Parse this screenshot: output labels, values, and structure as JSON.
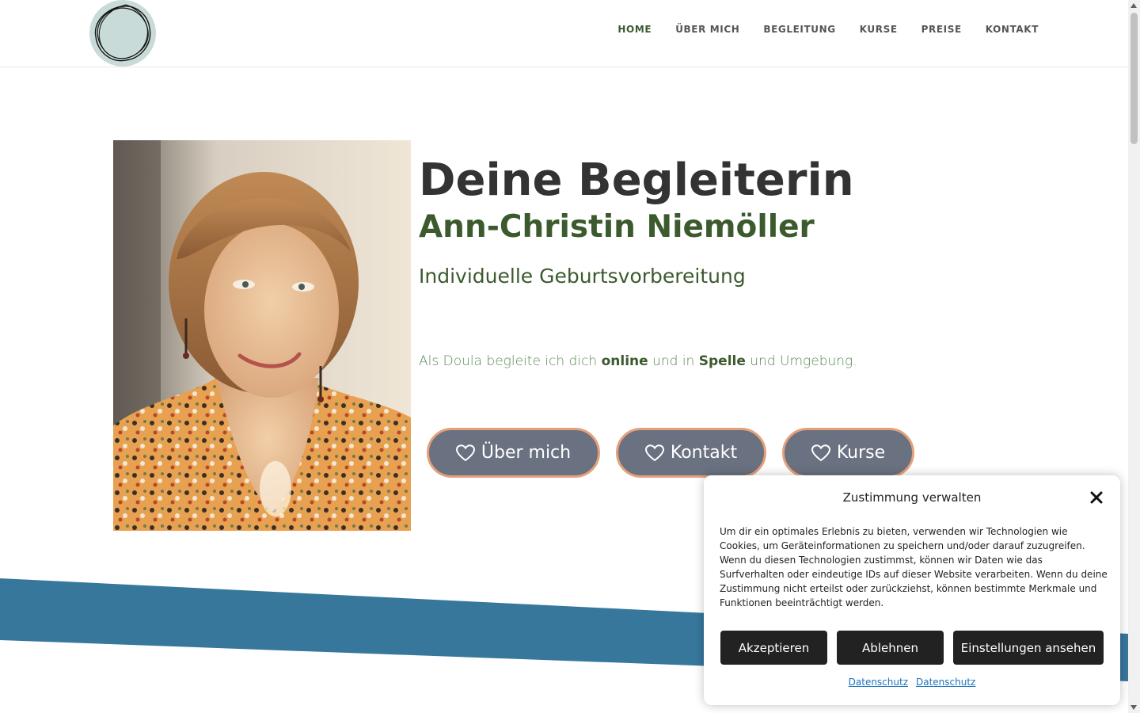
{
  "header": {
    "nav": [
      {
        "label": "HOME",
        "active": true
      },
      {
        "label": "ÜBER MICH"
      },
      {
        "label": "BEGLEITUNG"
      },
      {
        "label": "KURSE"
      },
      {
        "label": "PREISE"
      },
      {
        "label": "KONTAKT"
      }
    ]
  },
  "hero": {
    "title": "Deine Begleiterin",
    "name": "Ann-Christin Niemöller",
    "subtitle": "Individuelle Geburtsvorbereitung",
    "lead_part1": "Als Doula begleite ich dich ",
    "lead_bold1": "online",
    "lead_part2": " und in ",
    "lead_bold2": "Spelle",
    "lead_part3": " und Umgebung.",
    "buttons": {
      "about": "Über mich",
      "contact": "Kontakt",
      "courses": "Kurse"
    }
  },
  "consent": {
    "title": "Zustimmung verwalten",
    "text": "Um dir ein optimales Erlebnis zu bieten, verwenden wir Technologien wie Cookies, um Geräteinformationen zu speichern und/oder darauf zuzugreifen. Wenn du diesen Technologien zustimmst, können wir Daten wie das Surfverhalten oder eindeutige IDs auf dieser Website verarbeiten. Wenn du deine Zustimmung nicht erteilst oder zurückziehst, können bestimmte Merkmale und Funktionen beeinträchtigt werden.",
    "accept": "Akzeptieren",
    "deny": "Ablehnen",
    "settings": "Einstellungen ansehen",
    "links": [
      "Datenschutz",
      "Datenschutz"
    ]
  },
  "colors": {
    "brand_green": "#3b5a2d",
    "accent_blue": "#37779c",
    "button_fill": "#6a7180",
    "button_border": "#e4a07a",
    "logo_bg": "#c9dbd8"
  },
  "icons": {
    "button_icon": "heart-outline-icon",
    "close": "close-icon"
  }
}
